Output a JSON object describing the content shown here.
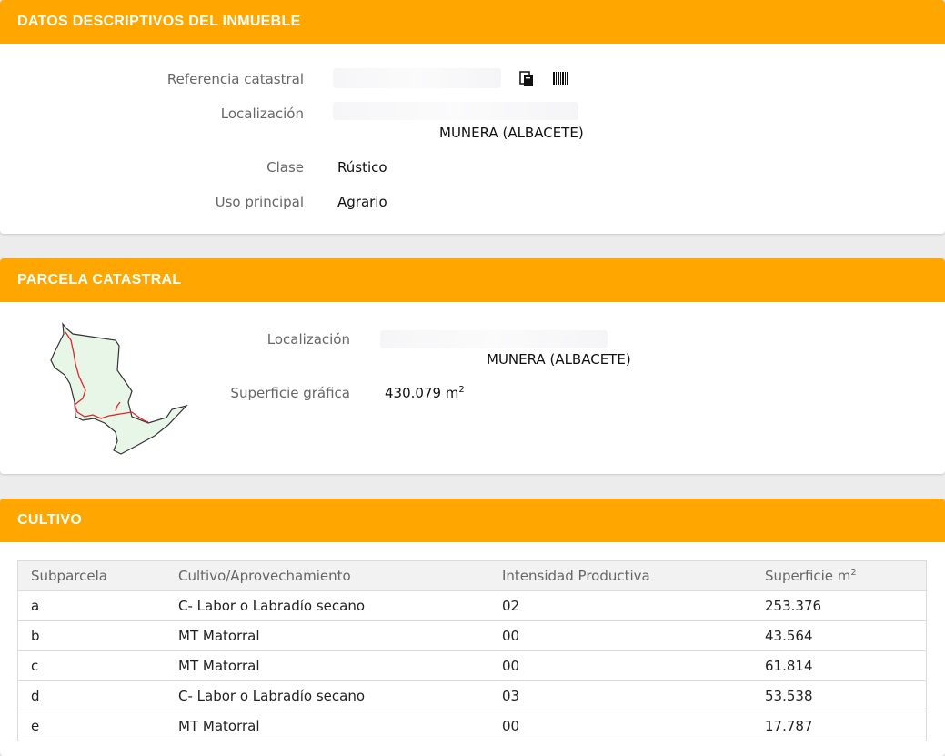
{
  "inmueble": {
    "title": "DATOS DESCRIPTIVOS DEL INMUEBLE",
    "ref_label": "Referencia catastral",
    "loc_label": "Localización",
    "loc_value": "MUNERA (ALBACETE)",
    "clase_label": "Clase",
    "clase_value": "Rústico",
    "uso_label": "Uso principal",
    "uso_value": "Agrario",
    "icons": [
      "copy-icon",
      "barcode-icon"
    ]
  },
  "parcela": {
    "title": "PARCELA CATASTRAL",
    "loc_label": "Localización",
    "loc_value": "MUNERA (ALBACETE)",
    "sup_label": "Superficie gráfica",
    "sup_value": "430.079 m",
    "sup_exp": "2",
    "map_fill": "#e8f6e8",
    "map_stroke": "#333333",
    "subdiv_stroke": "#e0262b"
  },
  "cultivo": {
    "title": "CULTIVO",
    "headers": [
      "Subparcela",
      "Cultivo/Aprovechamiento",
      "Intensidad Productiva",
      "Superficie m"
    ],
    "header_exp": "2",
    "rows": [
      [
        "a",
        "C- Labor o Labradío secano",
        "02",
        "253.376"
      ],
      [
        "b",
        "MT Matorral",
        "00",
        "43.564"
      ],
      [
        "c",
        "MT Matorral",
        "00",
        "61.814"
      ],
      [
        "d",
        "C- Labor o Labradío secano",
        "03",
        "53.538"
      ],
      [
        "e",
        "MT Matorral",
        "00",
        "17.787"
      ]
    ]
  },
  "colors": {
    "accent": "#ffa600"
  }
}
